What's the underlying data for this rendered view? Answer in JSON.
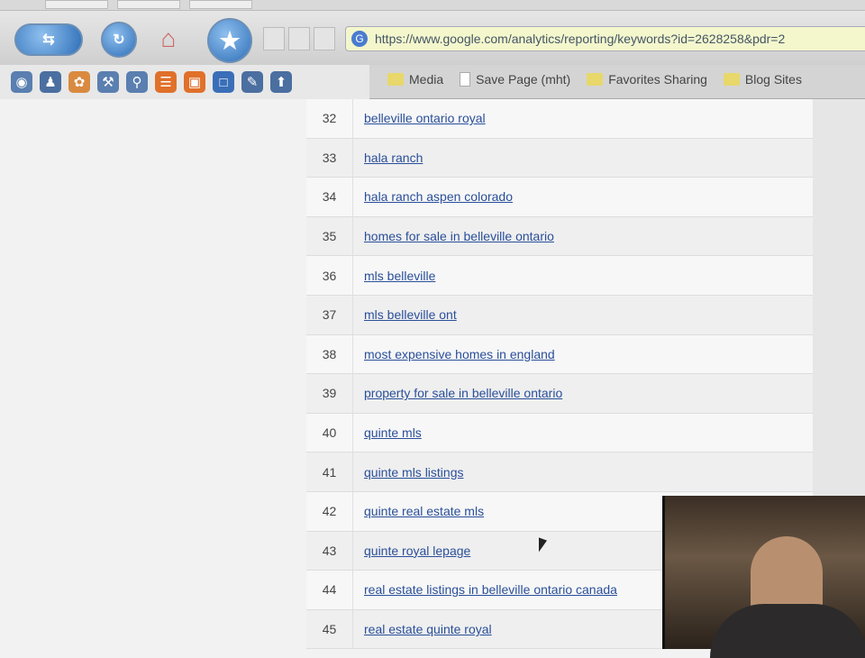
{
  "browser": {
    "url": "https://www.google.com/analytics/reporting/keywords?id=2628258&pdr=2"
  },
  "bookmarks": [
    {
      "label": "Media",
      "icon": "folder-icon"
    },
    {
      "label": "Save Page (mht)",
      "icon": "page-icon"
    },
    {
      "label": "Favorites Sharing",
      "icon": "folder-icon"
    },
    {
      "label": "Blog Sites",
      "icon": "folder-icon"
    }
  ],
  "rows": [
    {
      "num": "32",
      "keyword": "belleville ontario royal"
    },
    {
      "num": "33",
      "keyword": "hala ranch"
    },
    {
      "num": "34",
      "keyword": "hala ranch aspen colorado"
    },
    {
      "num": "35",
      "keyword": "homes for sale in belleville ontario"
    },
    {
      "num": "36",
      "keyword": "mls belleville"
    },
    {
      "num": "37",
      "keyword": "mls belleville ont"
    },
    {
      "num": "38",
      "keyword": "most expensive homes in england"
    },
    {
      "num": "39",
      "keyword": "property for sale in belleville ontario"
    },
    {
      "num": "40",
      "keyword": "quinte mls"
    },
    {
      "num": "41",
      "keyword": "quinte mls listings"
    },
    {
      "num": "42",
      "keyword": "quinte real estate mls"
    },
    {
      "num": "43",
      "keyword": "quinte royal lepage"
    },
    {
      "num": "44",
      "keyword": "real estate listings in belleville ontario canada"
    },
    {
      "num": "45",
      "keyword": "real estate quinte royal"
    }
  ]
}
